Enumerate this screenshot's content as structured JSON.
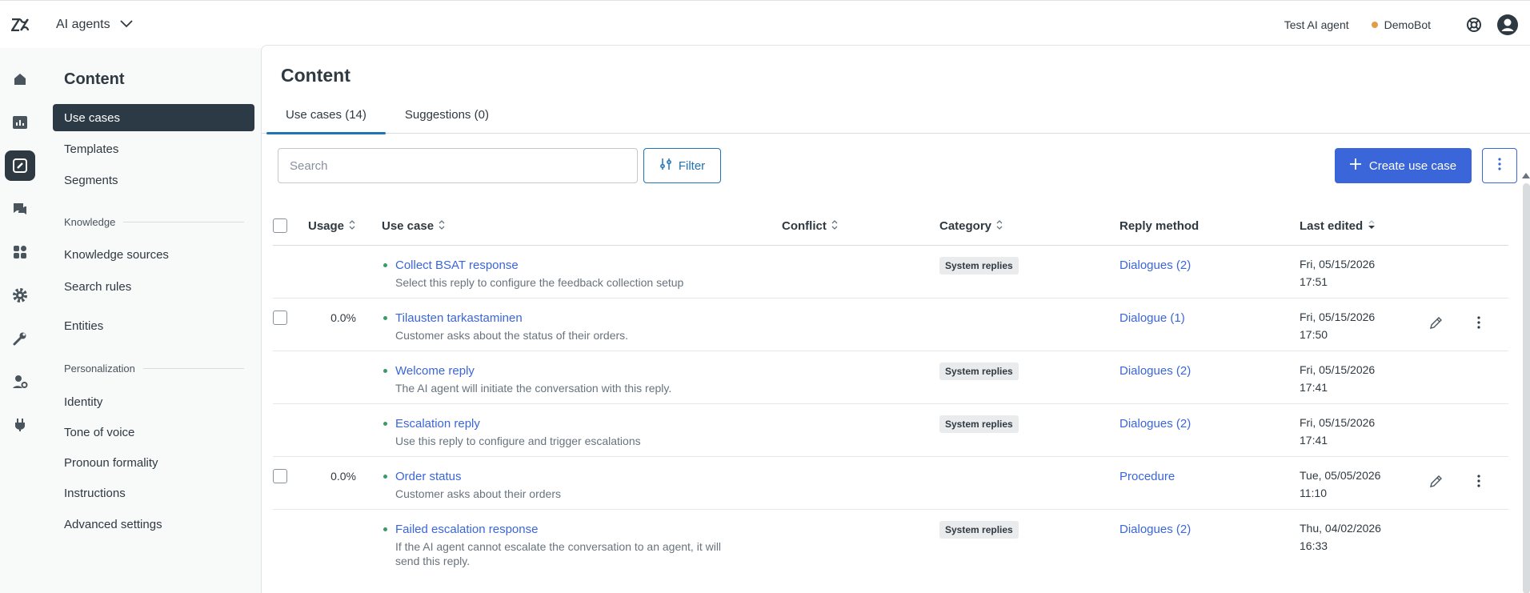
{
  "topbar": {
    "product_name": "AI agents",
    "agent_label": "Test AI agent",
    "bot_name": "DemoBot",
    "bot_status_color": "#e29b48"
  },
  "rail": {
    "items": [
      {
        "icon": "home-icon"
      },
      {
        "icon": "analytics-icon"
      },
      {
        "icon": "content-icon",
        "active": true
      },
      {
        "icon": "conversations-icon"
      },
      {
        "icon": "apps-icon"
      },
      {
        "icon": "settings-gear-icon"
      },
      {
        "icon": "wrench-icon"
      },
      {
        "icon": "user-settings-icon"
      },
      {
        "icon": "plugin-icon"
      }
    ]
  },
  "subnav": {
    "title": "Content",
    "items": [
      {
        "label": "Use cases",
        "active": true
      },
      {
        "label": "Templates"
      },
      {
        "label": "Segments"
      }
    ],
    "knowledge_title": "Knowledge",
    "knowledge_items": [
      {
        "label": "Knowledge sources"
      },
      {
        "label": "Search rules"
      },
      {
        "label": "Entities"
      }
    ],
    "personalization_title": "Personalization",
    "personalization_items": [
      {
        "label": "Identity"
      },
      {
        "label": "Tone of voice"
      },
      {
        "label": "Pronoun formality"
      },
      {
        "label": "Instructions"
      },
      {
        "label": "Advanced settings"
      }
    ]
  },
  "main": {
    "title": "Content",
    "tabs": [
      {
        "label": "Use cases (14)",
        "active": true
      },
      {
        "label": "Suggestions (0)"
      }
    ],
    "search_placeholder": "Search",
    "filter_label": "Filter",
    "create_label": "Create use case"
  },
  "table": {
    "headers": {
      "usage": "Usage",
      "use_case": "Use case",
      "conflict": "Conflict",
      "category": "Category",
      "reply_method": "Reply method",
      "last_edited": "Last edited"
    },
    "rows": [
      {
        "checkbox": false,
        "usage": "",
        "title": "Collect BSAT response",
        "description": "Select this reply to configure the feedback collection setup",
        "category": "System replies",
        "reply": "Dialogues (2)",
        "date": "Fri, 05/15/2026",
        "time": "17:51",
        "actions": false
      },
      {
        "checkbox": true,
        "usage": "0.0%",
        "title": "Tilausten tarkastaminen",
        "description": "Customer asks about the status of their orders.",
        "category": "",
        "reply": "Dialogue (1)",
        "date": "Fri, 05/15/2026",
        "time": "17:50",
        "actions": true
      },
      {
        "checkbox": false,
        "usage": "",
        "title": "Welcome reply",
        "description": "The AI agent will initiate the conversation with this reply.",
        "category": "System replies",
        "reply": "Dialogues (2)",
        "date": "Fri, 05/15/2026",
        "time": "17:41",
        "actions": false
      },
      {
        "checkbox": false,
        "usage": "",
        "title": "Escalation reply",
        "description": "Use this reply to configure and trigger escalations",
        "category": "System replies",
        "reply": "Dialogues (2)",
        "date": "Fri, 05/15/2026",
        "time": "17:41",
        "actions": false
      },
      {
        "checkbox": true,
        "usage": "0.0%",
        "title": "Order status",
        "description": "Customer asks about their orders",
        "category": "",
        "reply": "Procedure",
        "date": "Tue, 05/05/2026",
        "time": "11:10",
        "actions": true
      },
      {
        "checkbox": false,
        "usage": "",
        "title": "Failed escalation response",
        "description": "If the AI agent cannot escalate the conversation to an agent, it will send this reply.",
        "category": "System replies",
        "reply": "Dialogues (2)",
        "date": "Thu, 04/02/2026",
        "time": "16:33",
        "actions": false
      }
    ]
  }
}
